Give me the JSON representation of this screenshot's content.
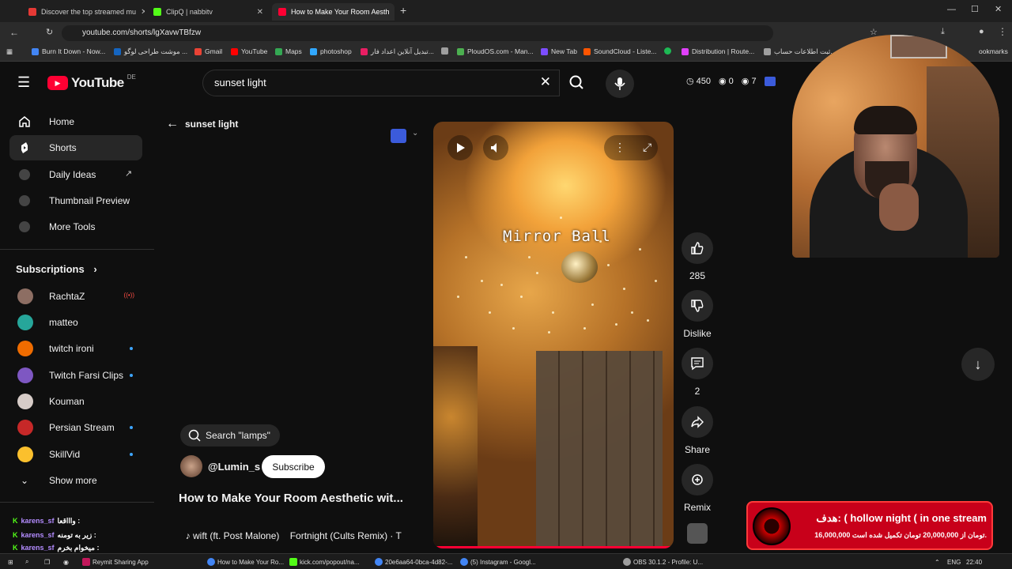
{
  "browser": {
    "tabs": [
      {
        "label": "Discover the top streamed mu",
        "color": "#e53935"
      },
      {
        "label": "ClipQ | nabbitv",
        "color": "#53fc18"
      },
      {
        "label": "How to Make Your Room Aesth",
        "color": "#ff0033",
        "active": true
      }
    ],
    "url": "youtube.com/shorts/lgXavwTBfzw",
    "bookmarks": [
      {
        "label": "Burn It Down - Now...",
        "color": "#4285f4"
      },
      {
        "label": "موشت طراحی لوگو ...",
        "color": "#1565c0"
      },
      {
        "label": "Gmail",
        "color": "#ea4335"
      },
      {
        "label": "YouTube",
        "color": "#ff0000"
      },
      {
        "label": "Maps",
        "color": "#34a853"
      },
      {
        "label": "photoshop",
        "color": "#31a8ff"
      },
      {
        "label": "تبدیل آنلاین اعداد فار...",
        "color": "#e91e63"
      },
      {
        "label": "",
        "color": "#9e9e9e"
      },
      {
        "label": "PloudOS.com - Man...",
        "color": "#4caf50"
      },
      {
        "label": "New Tab",
        "color": "#7c4dff"
      },
      {
        "label": "SoundCloud - Liste...",
        "color": "#ff5500"
      },
      {
        "label": "",
        "color": "#1db954"
      },
      {
        "label": "Distribution | Route...",
        "color": "#e040fb"
      },
      {
        "label": "ثبت اطلاعات حساب...",
        "color": "#9e9e9e"
      }
    ],
    "bookmarks_more": "ookmarks"
  },
  "youtube": {
    "logo_text": "YouTube",
    "region": "DE",
    "search_value": "sunset light",
    "stats": {
      "views": "450",
      "zero": "0",
      "seven": "7"
    }
  },
  "sidebar": {
    "items": [
      {
        "label": "Home",
        "icon": "home-icon"
      },
      {
        "label": "Shorts",
        "icon": "shorts-icon",
        "active": true
      },
      {
        "label": "Daily Ideas",
        "icon": "iq-icon"
      },
      {
        "label": "Thumbnail Preview",
        "icon": "iq-icon"
      },
      {
        "label": "More Tools",
        "icon": "iq-icon"
      }
    ],
    "subscriptions_title": "Subscriptions",
    "subscriptions": [
      {
        "name": "RachtaZ",
        "color": "#8d6e63",
        "status": "live"
      },
      {
        "name": "matteo",
        "color": "#26a69a",
        "status": ""
      },
      {
        "name": "twitch ironi",
        "color": "#ef6c00",
        "status": "dot"
      },
      {
        "name": "Twitch Farsi Clips",
        "color": "#7e57c2",
        "status": "dot"
      },
      {
        "name": "Kouman",
        "color": "#d7ccc8",
        "status": ""
      },
      {
        "name": "Persian Stream",
        "color": "#c62828",
        "status": "dot"
      },
      {
        "name": "SkillVid",
        "color": "#fbc02d",
        "status": "dot"
      }
    ],
    "show_more": "Show more"
  },
  "shorts": {
    "back_label": "sunset light",
    "search_chip": "Search \"lamps\"",
    "channel": "@Lumin_s",
    "subscribe": "Subscribe",
    "title": "How to Make Your Room Aesthetic wit...",
    "music": "wift (ft. Post Malone)    Fortnight (Cults Remix) · T",
    "overlay_text": "Mirror Ball",
    "actions": {
      "likes": "285",
      "dislike": "Dislike",
      "comments": "2",
      "share": "Share",
      "remix": "Remix"
    }
  },
  "donation": {
    "title": "هدف: ( hollow night ( in one stream",
    "subtitle": "16,000,000 تومان از 20,000,000 تومان تکمیل شده است."
  },
  "chat": [
    {
      "user": "karens_sf",
      "msg": "واااقعا :"
    },
    {
      "user": "karens_sf",
      "msg": "زیر به تومنه :"
    },
    {
      "user": "karens_sf",
      "msg": "میخوام بخرم :"
    }
  ],
  "taskbar": {
    "items": [
      {
        "label": "Reymit Sharing App",
        "color": "#c2185b"
      },
      {
        "label": "How to Make Your Ro...",
        "color": "#4285f4"
      },
      {
        "label": "kick.com/popout/na...",
        "color": "#53fc18"
      },
      {
        "label": "20e6aa64-0bca-4d82-...",
        "color": "#4285f4"
      },
      {
        "label": "(5) Instagram - Googl...",
        "color": "#4285f4"
      },
      {
        "label": "OBS 30.1.2 - Profile: U...",
        "color": "#9e9e9e"
      }
    ],
    "lang": "ENG",
    "time": "22:40"
  }
}
